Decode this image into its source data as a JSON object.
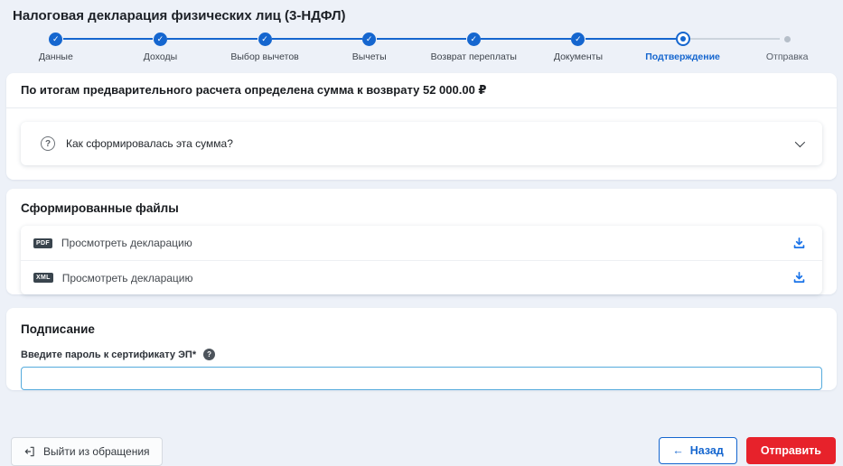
{
  "page": {
    "title": "Налоговая декларация физических лиц (3-НДФЛ)"
  },
  "stepper": {
    "steps": [
      {
        "label": "Данные",
        "state": "completed"
      },
      {
        "label": "Доходы",
        "state": "completed"
      },
      {
        "label": "Выбор вычетов",
        "state": "completed"
      },
      {
        "label": "Вычеты",
        "state": "completed"
      },
      {
        "label": "Возврат переплаты",
        "state": "completed"
      },
      {
        "label": "Документы",
        "state": "completed"
      },
      {
        "label": "Подтверждение",
        "state": "current"
      },
      {
        "label": "Отправка",
        "state": "upcoming"
      }
    ]
  },
  "summary": {
    "message": "По итогам предварительного расчета определена сумма к возврату 52 000.00 ₽",
    "refund_amount": "52 000.00 ₽",
    "accordion_question": "Как сформировалась эта сумма?"
  },
  "files": {
    "section_title": "Сформированные файлы",
    "items": [
      {
        "type": "PDF",
        "label": "Просмотреть декларацию"
      },
      {
        "type": "XML",
        "label": "Просмотреть декларацию"
      }
    ]
  },
  "signing": {
    "section_title": "Подписание",
    "password_label": "Введите пароль к сертификату ЭП*",
    "password_value": ""
  },
  "footer": {
    "exit_label": "Выйти из обращения",
    "back_label": "Назад",
    "submit_label": "Отправить"
  },
  "icons": {
    "check": "✓",
    "question": "?",
    "help": "?",
    "back_arrow": "←"
  },
  "colors": {
    "accent_blue": "#1566cf",
    "download_blue": "#1a73e8",
    "input_border": "#55abdd",
    "submit_red": "#e7222b",
    "page_background": "#edf1f8"
  }
}
